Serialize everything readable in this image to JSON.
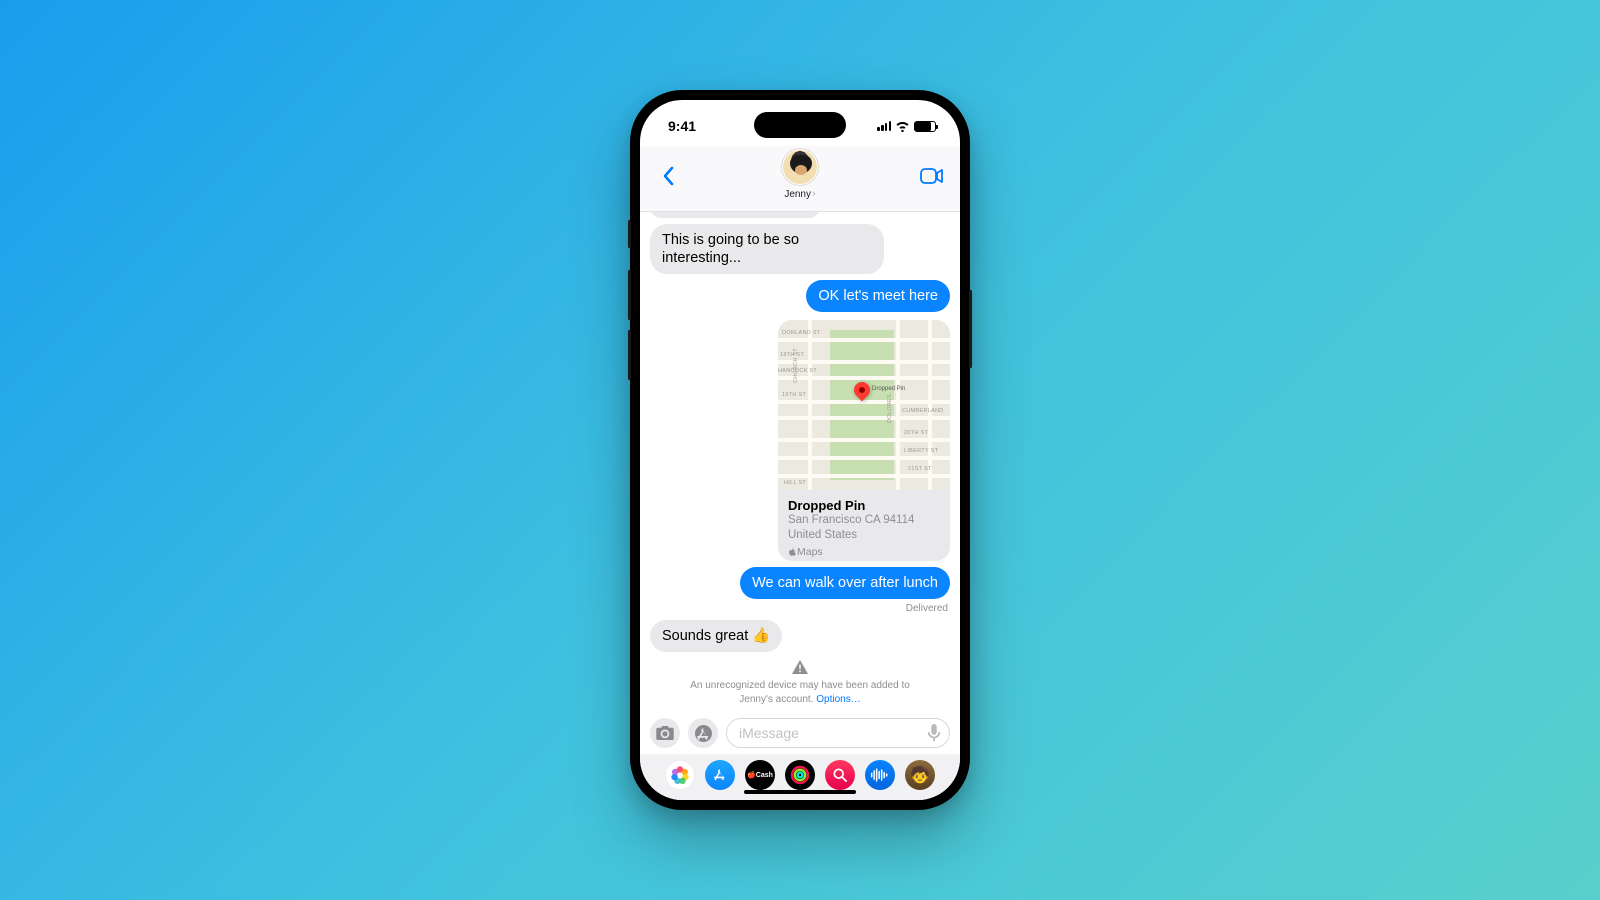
{
  "status": {
    "time": "9:41"
  },
  "header": {
    "contact_name": "Jenny"
  },
  "thread": {
    "msg_clip": "",
    "msg1": "This is going to be so interesting...",
    "msg2": "OK let's meet here",
    "map": {
      "title": "Dropped Pin",
      "line1": "San Francisco CA 94114",
      "line2": "United States",
      "app_name": "Maps",
      "pin_label": "Dropped Pin",
      "streets": [
        "DORLAND ST",
        "18TH ST",
        "HANCOCK ST",
        "19TH ST",
        "CUMBERLAND",
        "20TH ST",
        "LIBERTY ST",
        "21ST ST",
        "HILL ST",
        "DOLORES",
        "CHURCH ST"
      ]
    },
    "msg3": "We can walk over after lunch",
    "delivered": "Delivered",
    "msg4": "Sounds great 👍"
  },
  "warning": {
    "text": "An unrecognized device may have been added to Jenny's account.",
    "link": "Options…"
  },
  "compose": {
    "placeholder": "iMessage"
  },
  "apps": {
    "cash_label": "Cash"
  }
}
